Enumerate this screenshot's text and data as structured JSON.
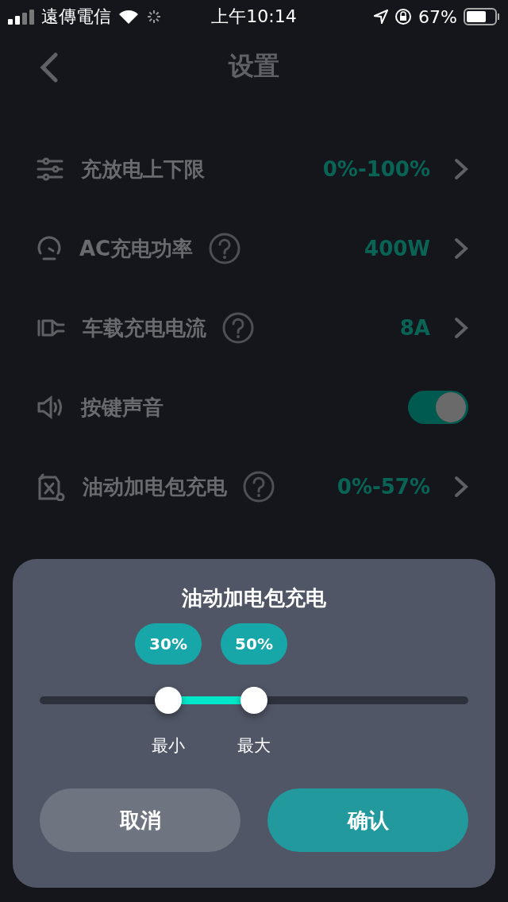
{
  "status_bar": {
    "carrier": "遠傳電信",
    "time": "上午10:14",
    "battery": "67%"
  },
  "nav": {
    "title": "设置"
  },
  "settings": [
    {
      "kind": "link",
      "label": "充放电上下限",
      "help": false,
      "value": "0%-100%"
    },
    {
      "kind": "link",
      "label": "AC充电功率",
      "help": true,
      "value": "400W"
    },
    {
      "kind": "link",
      "label": "车载充电电流",
      "help": true,
      "value": "8A"
    },
    {
      "kind": "toggle",
      "label": "按键声音",
      "help": false,
      "on": true
    },
    {
      "kind": "link",
      "label": "油动加电包充电",
      "help": true,
      "value": "0%-57%"
    }
  ],
  "sheet": {
    "title": "油动加电包充电",
    "thumbs": [
      {
        "badge": "30%",
        "label": "最小",
        "level": 0.3
      },
      {
        "badge": "50%",
        "label": "最大",
        "level": 0.5
      }
    ],
    "buttons": [
      {
        "kind": "cancel",
        "label": "取消"
      },
      {
        "kind": "confirm",
        "label": "确认"
      }
    ]
  }
}
